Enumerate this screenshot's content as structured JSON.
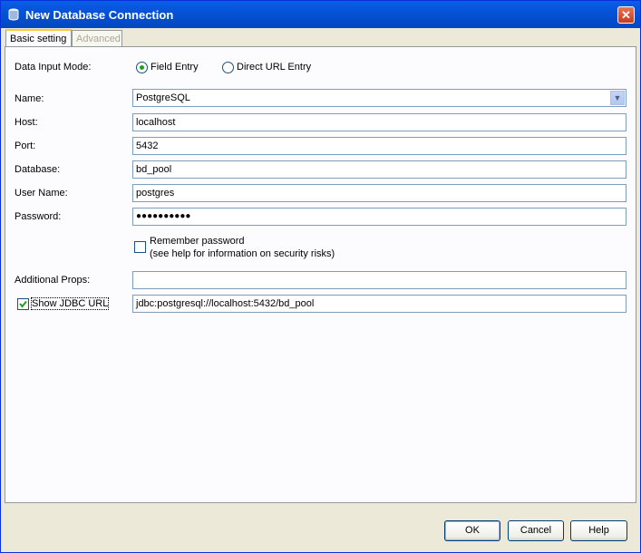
{
  "window": {
    "title": "New Database Connection"
  },
  "tabs": [
    {
      "label": "Basic setting",
      "active": true
    },
    {
      "label": "Advanced",
      "enabled": false
    }
  ],
  "input_mode": {
    "label": "Data Input Mode:",
    "options": [
      {
        "label": "Field Entry",
        "selected": true
      },
      {
        "label": "Direct URL Entry",
        "selected": false
      }
    ]
  },
  "form": {
    "name": {
      "label": "Name:",
      "value": "PostgreSQL"
    },
    "host": {
      "label": "Host:",
      "value": "localhost"
    },
    "port": {
      "label": "Port:",
      "value": "5432"
    },
    "database": {
      "label": "Database:",
      "value": "bd_pool"
    },
    "user_name": {
      "label": "User Name:",
      "value": "postgres"
    },
    "password": {
      "label": "Password:",
      "value": "●●●●●●●●●●"
    },
    "remember_password": {
      "line1": "Remember password",
      "line2": "(see help for information on security risks)",
      "checked": false
    },
    "additional_props": {
      "label": "Additional Props:",
      "value": ""
    },
    "show_jdbc_url": {
      "label": "Show JDBC URL",
      "checked": true,
      "value": "jdbc:postgresql://localhost:5432/bd_pool"
    }
  },
  "buttons": {
    "ok": "OK",
    "cancel": "Cancel",
    "help": "Help"
  },
  "icons": {
    "title": "database-icon",
    "close": "close-icon",
    "dropdown": "chevron-down-icon",
    "check": "checkmark-icon"
  },
  "colors": {
    "titlebar": "#0553d6",
    "window_bg": "#ece9d8",
    "panel_bg": "#fcfcfe",
    "radio_dot": "#21a121",
    "checkmark": "#21a121",
    "close_button": "#c7391c"
  }
}
